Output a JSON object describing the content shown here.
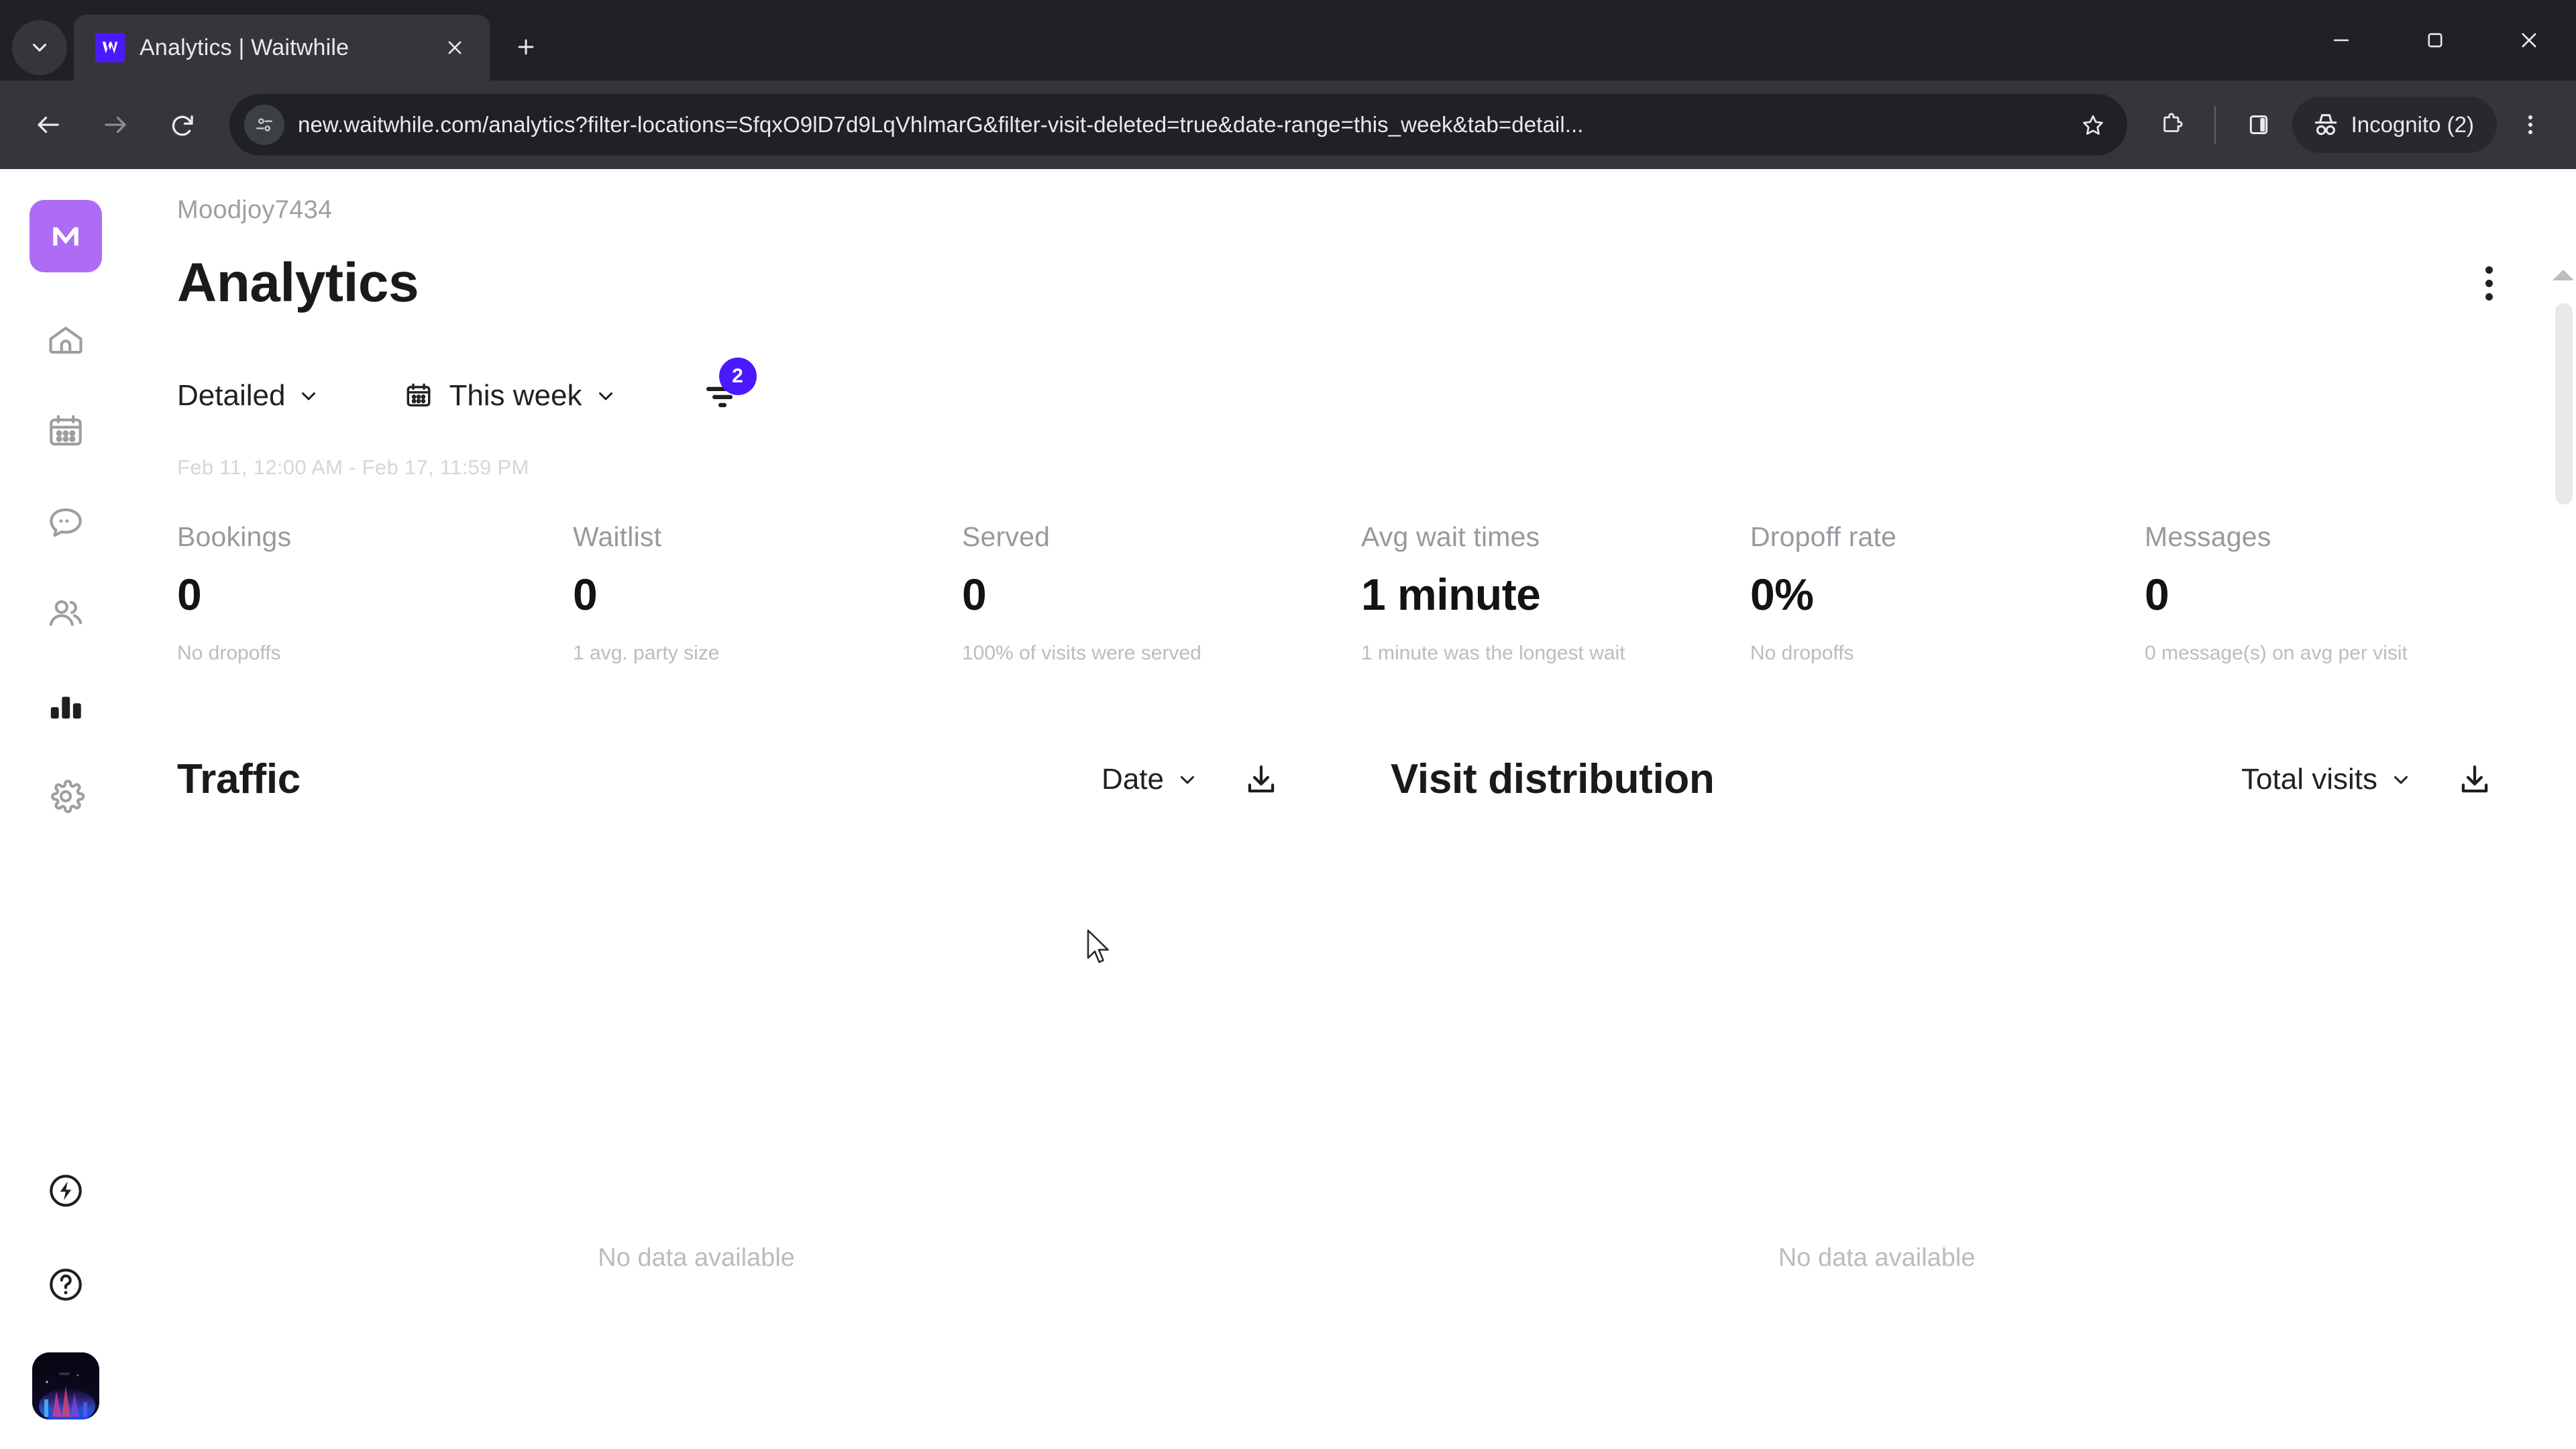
{
  "browser": {
    "tab_search_icon": "chevron-down-icon",
    "tab": {
      "title": "Analytics | Waitwhile",
      "favicon": "waitwhile-logo-icon",
      "close_icon": "close-icon"
    },
    "new_tab_icon": "plus-icon",
    "window_controls": {
      "minimize": "minimize-icon",
      "maximize": "maximize-icon",
      "close": "close-icon"
    },
    "nav": {
      "back_icon": "back-arrow-icon",
      "forward_icon": "forward-arrow-icon",
      "reload_icon": "reload-icon"
    },
    "omnibox": {
      "site_info_icon": "page-settings-icon",
      "url": "new.waitwhile.com/analytics?filter-locations=SfqxO9lD7d9LqVhlmarG&filter-visit-deleted=true&date-range=this_week&tab=detail...",
      "bookmark_icon": "star-icon"
    },
    "toolbar_right": {
      "extensions_icon": "puzzle-piece-icon",
      "side_panel_icon": "side-panel-icon",
      "incognito_label": "Incognito (2)",
      "incognito_icon": "incognito-hat-icon",
      "menu_icon": "three-dot-menu-icon"
    }
  },
  "sidebar": {
    "brand": {
      "letter": "M",
      "icon": "moodjoy-logo-icon",
      "color": "#ae6cf5"
    },
    "items": [
      {
        "name": "home",
        "icon": "home-icon"
      },
      {
        "name": "calendar",
        "icon": "calendar-icon"
      },
      {
        "name": "messages",
        "icon": "chat-bubble-icon"
      },
      {
        "name": "customers",
        "icon": "people-icon"
      },
      {
        "name": "analytics",
        "icon": "bar-chart-icon",
        "active": true
      },
      {
        "name": "settings",
        "icon": "gear-icon"
      }
    ],
    "bottom_items": [
      {
        "name": "power-up",
        "icon": "lightning-circle-icon"
      },
      {
        "name": "help",
        "icon": "question-circle-icon"
      },
      {
        "name": "user-avatar",
        "icon": "avatar-image"
      }
    ]
  },
  "header": {
    "org_name": "Moodjoy7434",
    "page_title": "Analytics",
    "menu_icon": "three-dot-menu-icon"
  },
  "controls": {
    "view_select": {
      "label": "Detailed",
      "chevron": "chevron-down-icon"
    },
    "date_select": {
      "label": "This week",
      "icon": "calendar-icon",
      "chevron": "chevron-down-icon"
    },
    "filter": {
      "icon": "filter-icon",
      "badge": "2",
      "badge_color": "#4a19ff"
    },
    "range_text": "Feb 11, 12:00 AM - Feb 17, 11:59 PM"
  },
  "metrics": [
    {
      "label": "Bookings",
      "value": "0",
      "sub": "No dropoffs"
    },
    {
      "label": "Waitlist",
      "value": "0",
      "sub": "1 avg. party size"
    },
    {
      "label": "Served",
      "value": "0",
      "sub": "100% of visits were served"
    },
    {
      "label": "Avg wait times",
      "value": "1 minute",
      "sub": "1 minute was the longest wait"
    },
    {
      "label": "Dropoff rate",
      "value": "0%",
      "sub": "No dropoffs"
    },
    {
      "label": "Messages",
      "value": "0",
      "sub": "0 message(s) on avg per visit"
    }
  ],
  "charts": [
    {
      "title": "Traffic",
      "select_label": "Date",
      "select_chevron": "chevron-down-icon",
      "download_icon": "download-icon",
      "empty_text": "No data available"
    },
    {
      "title": "Visit distribution",
      "select_label": "Total visits",
      "select_chevron": "chevron-down-icon",
      "download_icon": "download-icon",
      "empty_text": "No data available"
    }
  ],
  "scrollbar": {
    "arrow_up_icon": "scroll-up-arrow-icon"
  },
  "cursor": {
    "icon": "mouse-pointer-icon"
  }
}
